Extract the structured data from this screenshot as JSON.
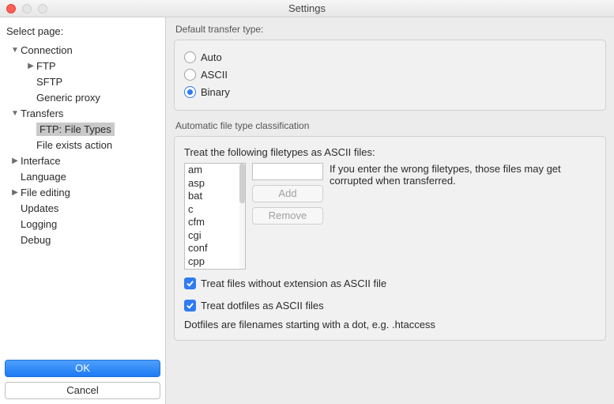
{
  "window": {
    "title": "Settings"
  },
  "sidebar": {
    "label": "Select page:",
    "items": [
      {
        "label": "Connection"
      },
      {
        "label": "FTP"
      },
      {
        "label": "SFTP"
      },
      {
        "label": "Generic proxy"
      },
      {
        "label": "Transfers"
      },
      {
        "label": "FTP: File Types"
      },
      {
        "label": "File exists action"
      },
      {
        "label": "Interface"
      },
      {
        "label": "Language"
      },
      {
        "label": "File editing"
      },
      {
        "label": "Updates"
      },
      {
        "label": "Logging"
      },
      {
        "label": "Debug"
      }
    ],
    "ok_label": "OK",
    "cancel_label": "Cancel"
  },
  "main": {
    "group1": {
      "title": "Default transfer type:",
      "options": {
        "auto": "Auto",
        "ascii": "ASCII",
        "binary": "Binary"
      },
      "selected": "Binary"
    },
    "group2": {
      "title": "Automatic file type classification",
      "treat_label": "Treat the following filetypes as ASCII files:",
      "filetypes": [
        "am",
        "asp",
        "bat",
        "c",
        "cfm",
        "cgi",
        "conf",
        "cpp"
      ],
      "input_value": "",
      "add_label": "Add",
      "remove_label": "Remove",
      "hint": "If you enter the wrong filetypes, those files may get corrupted when transferred.",
      "check1_label": "Treat files without extension as ASCII file",
      "check2_label": "Treat dotfiles as ASCII files",
      "note": "Dotfiles are filenames starting with a dot, e.g. .htaccess"
    }
  }
}
